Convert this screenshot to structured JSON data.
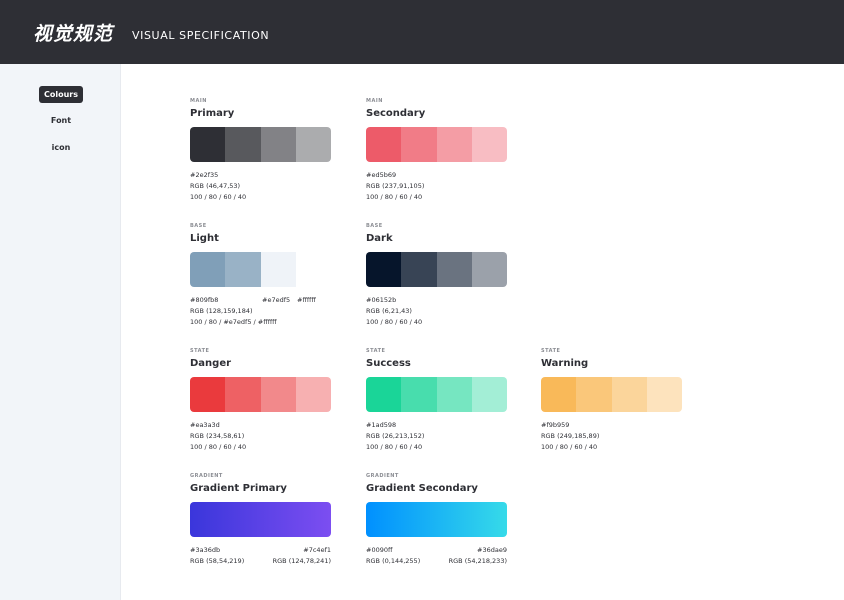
{
  "header": {
    "title_cn": "视觉规范",
    "title_en": "VISUAL SPECIFICATION"
  },
  "sidebar": {
    "items": [
      {
        "label": "Colours",
        "active": true
      },
      {
        "label": "Font",
        "active": false
      },
      {
        "label": "icon",
        "active": false
      }
    ]
  },
  "palettes": {
    "primary": {
      "category": "MAIN",
      "name": "Primary",
      "hex": "#2e2f35",
      "rgb": "RGB (46,47,53)",
      "opacity": "100 / 80 / 60 / 40",
      "swatches": [
        "#2e2f35",
        "#58595d",
        "#828286",
        "#abacae"
      ]
    },
    "secondary": {
      "category": "MAIN",
      "name": "Secondary",
      "hex": "#ed5b69",
      "rgb": "RGB (237,91,105)",
      "opacity": "100 / 80 / 60 / 40",
      "swatches": [
        "#ed5b69",
        "#f17c87",
        "#f49da5",
        "#f8bdc3"
      ]
    },
    "light": {
      "category": "BASE",
      "name": "Light",
      "hex": "#809fb8",
      "hex2": "#e7edf5",
      "hex3": "#ffffff",
      "rgb": "RGB (128,159,184)",
      "opacity": "100 / 80 / #e7edf5 / #ffffff",
      "swatches": [
        "#809fb8",
        "#99b2c6",
        "#eff3f8",
        "#ffffff"
      ]
    },
    "dark": {
      "category": "BASE",
      "name": "Dark",
      "hex": "#06152b",
      "rgb": "RGB (6,21,43)",
      "opacity": "100 / 80 / 60 / 40",
      "swatches": [
        "#06152b",
        "#384455",
        "#6a7380",
        "#9ba1aa"
      ]
    },
    "danger": {
      "category": "STATE",
      "name": "Danger",
      "hex": "#ea3a3d",
      "rgb": "RGB (234,58,61)",
      "opacity": "100 / 80 / 60 / 40",
      "swatches": [
        "#ea3a3d",
        "#ee6164",
        "#f2898b",
        "#f7b0b1"
      ]
    },
    "success": {
      "category": "STATE",
      "name": "Success",
      "hex": "#1ad598",
      "rgb": "RGB (26,213,152)",
      "opacity": "100 / 80 / 60 / 40",
      "swatches": [
        "#1ad598",
        "#48ddad",
        "#76e6c1",
        "#a3eed6"
      ]
    },
    "warning": {
      "category": "STATE",
      "name": "Warning",
      "hex": "#f9b959",
      "rgb": "RGB (249,185,89)",
      "opacity": "100 / 80 / 60 / 40",
      "swatches": [
        "#f9b959",
        "#fac77a",
        "#fbd59b",
        "#fde3bd"
      ]
    },
    "gradient_primary": {
      "category": "GRADIENT",
      "name": "Gradient Primary",
      "hex_start": "#3a36db",
      "hex_end": "#7c4ef1",
      "rgb_start": "RGB (58,54,219)",
      "rgb_end": "RGB (124,78,241)"
    },
    "gradient_secondary": {
      "category": "GRADIENT",
      "name": "Gradient Secondary",
      "hex_start": "#0090ff",
      "hex_end": "#36dae9",
      "rgb_start": "RGB (0,144,255)",
      "rgb_end": "RGB (54,218,233)"
    }
  }
}
